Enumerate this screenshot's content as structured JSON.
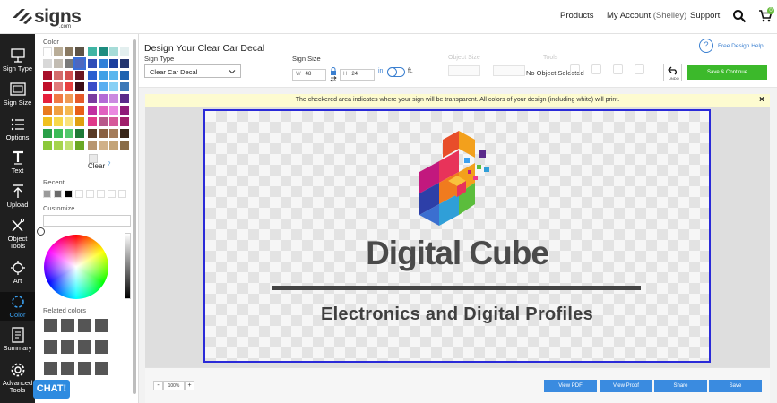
{
  "brand": {
    "logo_text": "signs",
    "logo_sub": ".com"
  },
  "nav": {
    "products": "Products",
    "account": "My Account",
    "account_user": "(Shelley)",
    "support": "Support",
    "cart_count": "0"
  },
  "sidebar": {
    "items": [
      {
        "label": "Sign Type",
        "icon": "sign-type-icon"
      },
      {
        "label": "Sign Size",
        "icon": "sign-size-icon"
      },
      {
        "label": "Options",
        "icon": "options-icon"
      },
      {
        "label": "Text",
        "icon": "text-icon"
      },
      {
        "label": "Upload",
        "icon": "upload-icon"
      },
      {
        "label": "Object Tools",
        "icon": "object-tools-icon"
      },
      {
        "label": "Art",
        "icon": "art-icon"
      },
      {
        "label": "Color",
        "icon": "color-icon"
      },
      {
        "label": "Summary",
        "icon": "summary-icon"
      },
      {
        "label": "Advanced Tools",
        "icon": "gear-icon"
      }
    ],
    "active": "Color"
  },
  "color_panel": {
    "title": "Color",
    "clear_label": "Clear",
    "recent_label": "Recent",
    "customize_label": "Customize",
    "related_label": "Related colors",
    "palette": [
      [
        "#ffffff",
        "#b9ad98",
        "#8a7a62",
        "#5d5346",
        "#3fb5a4",
        "#1d8c7f",
        "#a6dcd8",
        "#e3efef"
      ],
      [
        "#d8d8d8",
        "#c2bcb2",
        "#7a7a7a",
        "#4d68c0",
        "#2e4db8",
        "#2f7fd8",
        "#1b3f9e",
        "#243670"
      ],
      [
        "#a8102a",
        "#d36c6c",
        "#d35050",
        "#6b1522",
        "#2a5fd0",
        "#3fa0e6",
        "#5bb6ee",
        "#1d62b0"
      ],
      [
        "#c0102a",
        "#e07a7a",
        "#e84040",
        "#3c0d16",
        "#3a4dc8",
        "#59aef0",
        "#88d0f5",
        "#3b78b8"
      ],
      [
        "#e6203c",
        "#f07a44",
        "#f09a54",
        "#e55a2a",
        "#7a3ca0",
        "#b46ad6",
        "#cb8ae0",
        "#5a2a8a"
      ],
      [
        "#e87a20",
        "#f0a040",
        "#f5b850",
        "#e85f18",
        "#c030a0",
        "#e060c0",
        "#ea8ae0",
        "#901c78"
      ],
      [
        "#f0c020",
        "#f8d84a",
        "#fae27a",
        "#e0a010",
        "#e03a8a",
        "#b8588a",
        "#d65a9a",
        "#a0206a"
      ],
      [
        "#2aa048",
        "#3cbc58",
        "#52c86c",
        "#1e7a36",
        "#5a3a24",
        "#8a6040",
        "#a47c5a",
        "#3a2618"
      ],
      [
        "#8cc83a",
        "#a6d44e",
        "#bfe070",
        "#6aa824",
        "#b89670",
        "#d0b088",
        "#c4a478",
        "#8a6c48"
      ]
    ],
    "selected_swatch": [
      1,
      3
    ],
    "recent": [
      "#9a9a9a",
      "#6a6a6a",
      "#000000",
      "#ffffff",
      "#ffffff",
      "#ffffff",
      "#ffffff",
      "#ffffff"
    ],
    "related": [
      "#555555",
      "#555555",
      "#555555",
      "#555555",
      "#555555",
      "#555555",
      "#555555",
      "#555555",
      "#555555",
      "#555555",
      "#555555",
      "#555555"
    ]
  },
  "toolbar": {
    "design_title": "Design Your Clear Car Decal",
    "sign_type_label": "Sign Type",
    "sign_type_value": "Clear Car Decal",
    "sign_size_label": "Sign Size",
    "width_prefix": "W",
    "width_value": "48",
    "height_prefix": "H",
    "height_value": "24",
    "unit_in": "in",
    "unit_ft": "ft.",
    "object_size_label": "Object Size",
    "tools_label": "Tools",
    "no_object": "No Object Selected",
    "undo_label": "UNDO",
    "save_continue": "Save & Continue",
    "help_symbol": "?",
    "help_text": "Free Design Help"
  },
  "notice": {
    "text": "The checkered area indicates where your sign will be transparent. All colors of your design (including white) will print.",
    "close": "×"
  },
  "design": {
    "brand_name": "Digital Cube",
    "tagline": "Electronics and Digital Profiles"
  },
  "bottom": {
    "zoom_minus": "-",
    "zoom_value": "100%",
    "zoom_plus": "+",
    "view_pdf": "View PDF",
    "view_proof": "View Proof",
    "share": "Share",
    "save": "Save"
  },
  "chat": {
    "label": "CHAT!"
  }
}
